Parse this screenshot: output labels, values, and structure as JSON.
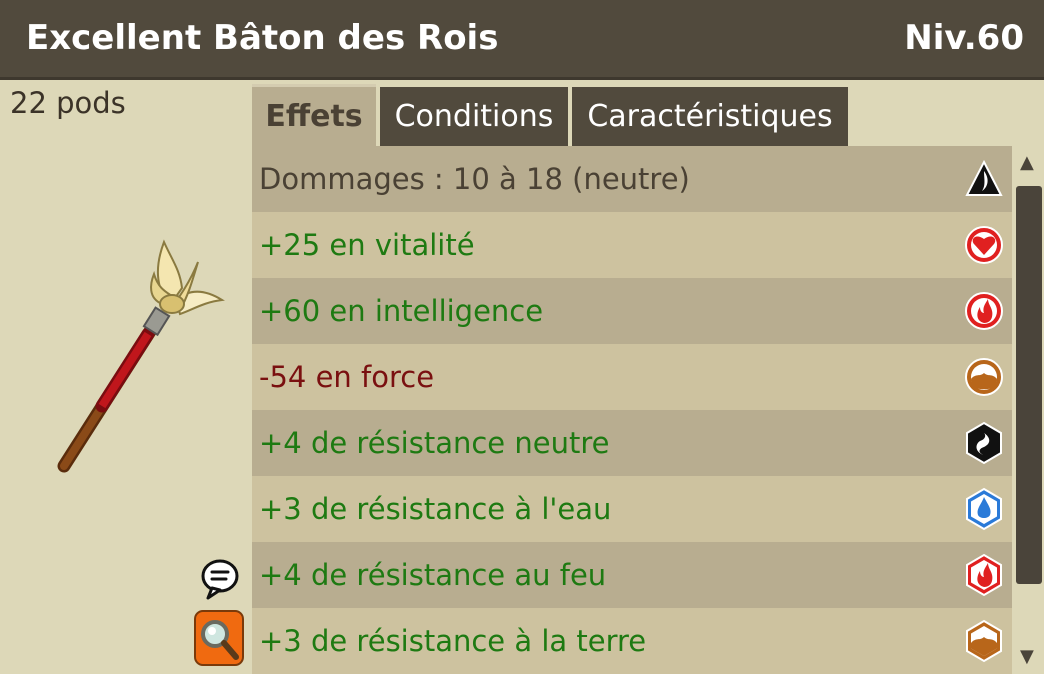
{
  "item": {
    "name": "Excellent Bâton des Rois",
    "level": "Niv.60",
    "weight": "22 pods"
  },
  "tabs": [
    {
      "label": "Effets",
      "active": true
    },
    {
      "label": "Conditions",
      "active": false
    },
    {
      "label": "Caractéristiques",
      "active": false
    }
  ],
  "effects": [
    {
      "text": "Dommages : 10 à 18 (neutre)",
      "color": "#4a4134",
      "icon": "neutral-damage-icon"
    },
    {
      "text": "+25 en vitalité",
      "color": "#1e7a12",
      "icon": "vitality-heart-icon"
    },
    {
      "text": "+60 en intelligence",
      "color": "#1e7a12",
      "icon": "intelligence-fire-icon"
    },
    {
      "text": "-54 en force",
      "color": "#7a1010",
      "icon": "strength-earth-icon"
    },
    {
      "text": "+4 de résistance neutre",
      "color": "#1e7a12",
      "icon": "neutral-resistance-icon"
    },
    {
      "text": "+3 de résistance à l'eau",
      "color": "#1e7a12",
      "icon": "water-resistance-icon"
    },
    {
      "text": "+4 de résistance au feu",
      "color": "#1e7a12",
      "icon": "fire-resistance-icon"
    },
    {
      "text": "+3 de résistance à la terre",
      "color": "#1e7a12",
      "icon": "earth-resistance-icon"
    }
  ]
}
